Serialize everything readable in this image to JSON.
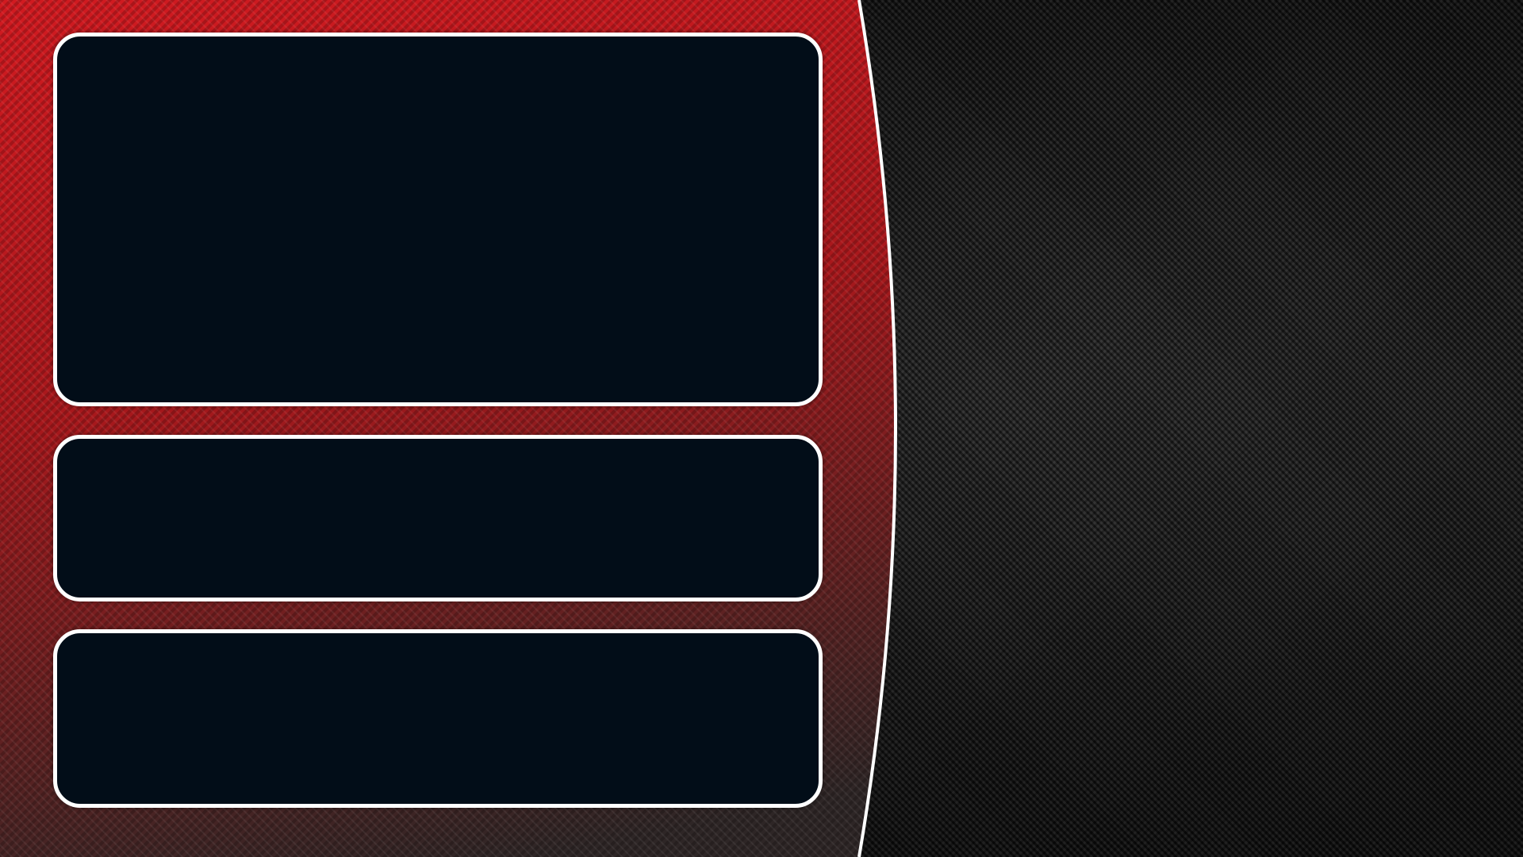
{
  "theme": {
    "left_panel_color": "#c4161c",
    "left_panel_dark_color": "#3a2a2a",
    "right_panel_color": "#1a1a1a",
    "slot_fill_color": "#020d18",
    "slot_border_color": "#ffffff",
    "divider_color": "#ffffff"
  },
  "slots": [
    {
      "name": "main-slot",
      "label": ""
    },
    {
      "name": "middle-slot",
      "label": ""
    },
    {
      "name": "bottom-slot",
      "label": ""
    }
  ]
}
